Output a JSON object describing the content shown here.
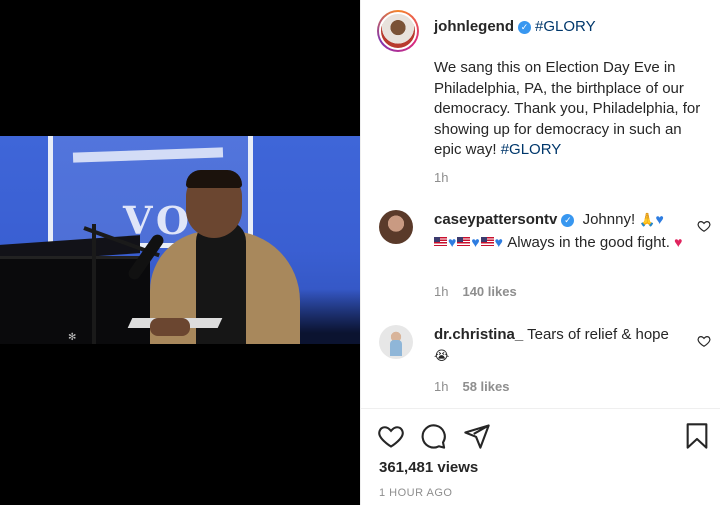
{
  "post": {
    "author": "johnlegend",
    "title_hashtag": "#GLORY",
    "caption_text": "We sang this on Election Day Eve in Philadelphia, PA, the birthplace of our democracy. Thank you, Philadelphia, for showing up for democracy in such an epic way!",
    "caption_hashtag": "#GLORY",
    "caption_time": "1h",
    "views": "361,481 views",
    "posted": "1 HOUR AGO"
  },
  "video": {
    "sign_text": "VOT"
  },
  "comments": [
    {
      "username": "caseypattersontv",
      "verified": true,
      "text_start": "Johnny!",
      "text_mid": "Always in the good fight.",
      "time": "1h",
      "likes": "140 likes"
    },
    {
      "username": "dr.christina_",
      "verified": false,
      "text_start": "Tears of relief & hope",
      "time": "1h",
      "likes": "58 likes"
    }
  ],
  "icons": {
    "like": "heart-icon",
    "comment": "comment-icon",
    "share": "share-icon",
    "save": "bookmark-icon",
    "verified": "verified-badge-icon"
  },
  "colors": {
    "hashtag": "#00376b",
    "verified": "#3897f0",
    "muted": "#8e8e8e"
  }
}
